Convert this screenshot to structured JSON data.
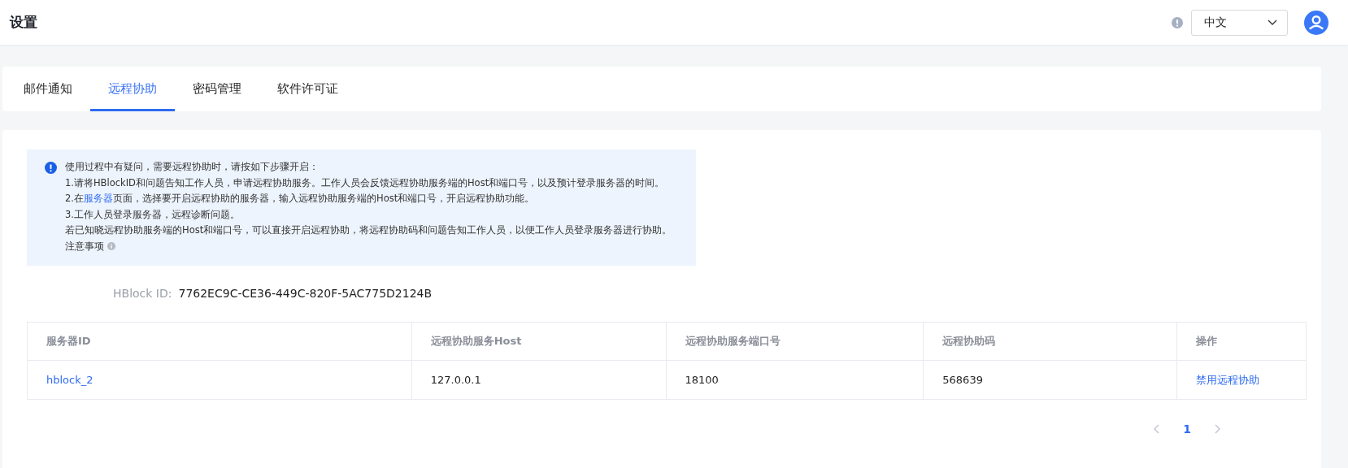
{
  "header": {
    "title": "设置",
    "language": {
      "value": "中文"
    }
  },
  "tabs": [
    {
      "label": "邮件通知",
      "selected": false
    },
    {
      "label": "远程协助",
      "selected": true
    },
    {
      "label": "密码管理",
      "selected": false
    },
    {
      "label": "软件许可证",
      "selected": false
    }
  ],
  "alert": {
    "lines": [
      {
        "text": "使用过程中有疑问，需要远程协助时，请按如下步骤开启："
      },
      {
        "text": "1.请将HBlockID和问题告知工作人员，申请远程协助服务。工作人员会反馈远程协助服务端的Host和端口号，以及预计登录服务器的时间。"
      },
      {
        "text": "2.在",
        "link": "服务器",
        "after": "页面，选择要开启远程协助的服务器，输入远程协助服务端的Host和端口号，开启远程协助功能。"
      },
      {
        "text": "3.工作人员登录服务器，远程诊断问题。"
      },
      {
        "text": "若已知晓远程协助服务端的Host和端口号，可以直接开启远程协助，将远程协助码和问题告知工作人员，以便工作人员登录服务器进行协助。"
      }
    ],
    "note": "注意事项"
  },
  "hblock": {
    "label": "HBlock ID:",
    "value": "7762EC9C-CE36-449C-820F-5AC775D2124B"
  },
  "table": {
    "columns": [
      "服务器ID",
      "远程协助服务Host",
      "远程协助服务端口号",
      "远程协助码",
      "操作"
    ],
    "rows": [
      {
        "server_id": "hblock_2",
        "host": "127.0.0.1",
        "port": "18100",
        "code": "568639",
        "action": "禁用远程协助"
      }
    ]
  },
  "pagination": {
    "pages": [
      {
        "label": "1",
        "selected": true
      }
    ],
    "prev_disabled": true,
    "next_disabled": true
  }
}
